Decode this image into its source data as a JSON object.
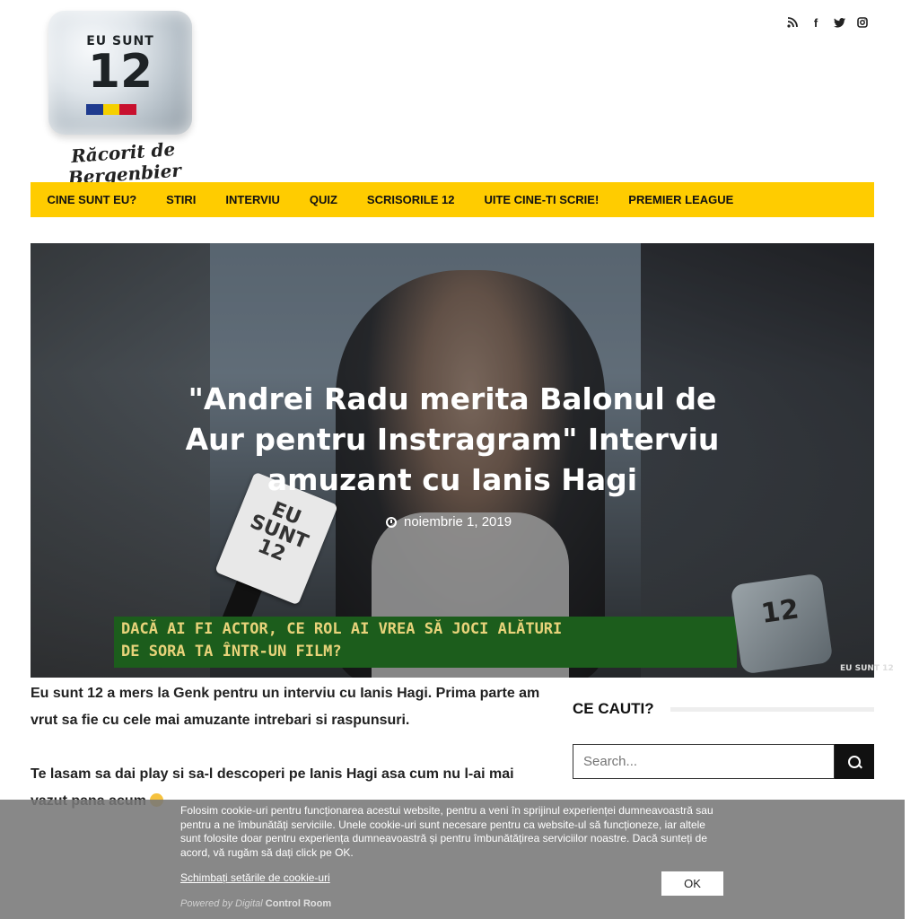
{
  "logo": {
    "line1": "EU SUNT",
    "line2": "12",
    "tagline": "Răcorit de Bergenbier",
    "flag_colors": [
      "#1f3b8f",
      "#f5d000",
      "#c8102e"
    ]
  },
  "social": {
    "items": [
      "rss-icon",
      "facebook-icon",
      "twitter-icon",
      "instagram-icon"
    ],
    "glyphs": [
      "●",
      "f",
      "t",
      "▢"
    ]
  },
  "nav": {
    "items": [
      "CINE SUNT EU?",
      "STIRI",
      "INTERVIU",
      "QUIZ",
      "SCRISORILE 12",
      "UITE CINE-TI SCRIE!",
      "PREMIER LEAGUE"
    ]
  },
  "hero": {
    "title": "\"Andrei Radu merita Balonul de Aur pentru Instragram\" Interviu amuzant cu Ianis Hagi",
    "date": "noiembrie 1, 2019",
    "banner_line1": "DACĂ AI FI ACTOR, CE ROL AI VREA SĂ JOCI ALĂTURI",
    "banner_line2": "DE SORA TA ÎNTR-UN FILM?",
    "mic_text": "EU SUNT 12",
    "corner_logo": "12",
    "corner_small": "EU SUNT 12"
  },
  "article": {
    "p1": "Eu sunt 12 a mers la Genk pentru un interviu cu Ianis Hagi. Prima parte am vrut sa fie cu cele mai amuzante intrebari si raspunsuri.",
    "p2": "Te lasam sa dai play si sa-l descoperi pe Ianis Hagi asa cum nu l-ai mai vazut pana acum"
  },
  "sidebar": {
    "title": "CE CAUTI?",
    "search_placeholder": "Search..."
  },
  "cookie": {
    "text": "Folosim cookie-uri pentru funcționarea acestui website, pentru a veni în sprijinul experienței dumneavoastră sau pentru a ne îmbunătăți serviciile. Unele cookie-uri sunt necesare pentru ca website-ul să funcționeze, iar altele sunt folosite doar pentru experiența dumneavoastră și pentru îmbunătățirea serviciilor noastre. Dacă sunteți de acord, vă rugăm să dați click pe OK.",
    "settings_link": "Schimbați setările de cookie-uri",
    "powered_prefix": "Powered by",
    "powered_brand": "Digital",
    "powered_name": "Control Room",
    "ok_label": "OK"
  }
}
